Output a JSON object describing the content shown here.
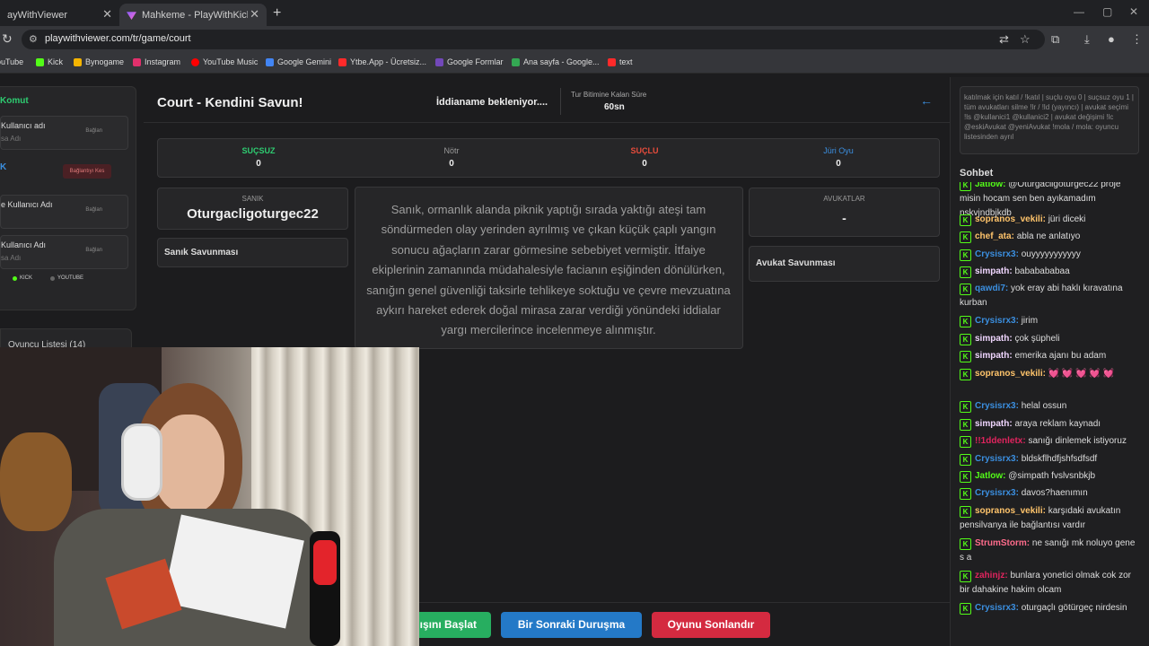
{
  "browser": {
    "tabs": [
      {
        "label": "ayWithViewer"
      },
      {
        "label": "Mahkeme - PlayWithKick | Play"
      }
    ],
    "url": "playwithviewer.com/tr/game/court",
    "bookmarks": [
      {
        "label": "ouTube",
        "color": "#ff0000"
      },
      {
        "label": "Kick",
        "color": "#53fc18"
      },
      {
        "label": "Bynogame",
        "color": "#f5b400"
      },
      {
        "label": "Instagram",
        "color": "#e1306c"
      },
      {
        "label": "YouTube Music",
        "color": "#ff0000"
      },
      {
        "label": "Google Gemini",
        "color": "#4285f4"
      },
      {
        "label": "Ytbe.App - Ücretsiz...",
        "color": "#ff2a2a"
      },
      {
        "label": "Google Formlar",
        "color": "#7248b9"
      },
      {
        "label": "Ana sayfa - Google...",
        "color": "#34a853"
      },
      {
        "label": "text",
        "color": "#ff2a2a"
      }
    ]
  },
  "left": {
    "komut": "Komut",
    "boxes": [
      {
        "title": "Kullanıcı adı",
        "sub": "sa Adı",
        "btn": "Bağlan"
      },
      {
        "title": "e Kullanıcı Adı",
        "sub": "",
        "btn": "Bağlan"
      },
      {
        "title": "Kullanıcı Adı",
        "sub": "sa Adı",
        "btn": "Bağlan"
      }
    ],
    "k_label": "K",
    "disconnect": "Bağlantıyı Kes",
    "platforms": [
      "KICK",
      "YOUTUBE"
    ],
    "player_list": "Oyuncu Listesi (14)"
  },
  "header": {
    "title": "Court - Kendini Savun!",
    "status": "İddianame bekleniyor....",
    "timer_label": "Tur Bitimine Kalan Süre",
    "timer_value": "60sn"
  },
  "votes": [
    {
      "label": "SUÇSUZ",
      "value": "0",
      "color": "#2ecc71"
    },
    {
      "label": "Nötr",
      "value": "0",
      "color": "#9a9a9a"
    },
    {
      "label": "SUÇLU",
      "value": "0",
      "color": "#e74c3c"
    },
    {
      "label": "Jüri Oyu",
      "value": "0",
      "color": "#3b8fe0"
    }
  ],
  "defendant": {
    "label": "SANIK",
    "name": "Oturgacligoturgec22",
    "defense_title": "Sanık Savunması"
  },
  "indictment": "Sanık, ormanlık alanda piknik yaptığı sırada yaktığı ateşi tam söndürmeden olay yerinden ayrılmış ve çıkan küçük çaplı yangın sonucu ağaçların zarar görmesine sebebiyet vermiştir. İtfaiye ekiplerinin zamanında müdahalesiyle facianın eşiğinden dönülürken, sanığın genel güvenliği taksirle tehlikeye soktuğu ve çevre mevzuatına aykırı hareket ederek doğal mirasa zarar verdiği yönündeki iddialar yargı mercilerince incelenmeye alınmıştır.",
  "lawyers": {
    "label": "AVUKATLAR",
    "value": "-",
    "defense_title": "Avukat Savunması"
  },
  "buttons": {
    "start": "ışını Başlat",
    "next": "Bir Sonraki Duruşma",
    "end": "Oyunu Sonlandır"
  },
  "commands_text": "katılmak için katıl / !katıl | suçlu oyu 0 | suçsuz oyu 1 | tüm avukatları silme !lr / !ld (yayıncı) | avukat seçimi !ls @kullanici1 @kullanici2 | avukat değişimi !lc @eskiAvukat @yeniAvukat !mola / mola: oyuncu listesinden ayrıl",
  "chat_title": "Sohbet",
  "chat": [
    {
      "user": "Jatlow:",
      "color": "#53fc18",
      "text": "@Oturgacligoturgec22 proje misin hocam sen ben ayıkamadım nskvjndbjkdb"
    },
    {
      "user": "sopranos_vekili:",
      "color": "#ffc46b",
      "text": "jüri diceki"
    },
    {
      "user": "chef_ata:",
      "color": "#ffc46b",
      "text": "abla ne anlatıyo"
    },
    {
      "user": "Crysisrx3:",
      "color": "#3b8fe0",
      "text": "ouyyyyyyyyyyy"
    },
    {
      "user": "simpath:",
      "color": "#f0d6ff",
      "text": "bababababaa"
    },
    {
      "user": "qawdi7:",
      "color": "#3b8fe0",
      "text": "yok eray abi haklı kıravatına kurban"
    },
    {
      "user": "Crysisrx3:",
      "color": "#3b8fe0",
      "text": "jirim"
    },
    {
      "user": "simpath:",
      "color": "#f0d6ff",
      "text": "çok şüpheli"
    },
    {
      "user": "simpath:",
      "color": "#f0d6ff",
      "text": "emerika ajanı bu adam"
    },
    {
      "user": "sopranos_vekili:",
      "color": "#ffc46b",
      "text": "💓 💓 💓 💓 💓"
    },
    {
      "user": "Crysisrx3:",
      "color": "#3b8fe0",
      "text": "helal ossun"
    },
    {
      "user": "simpath:",
      "color": "#f0d6ff",
      "text": "araya reklam kaynadı"
    },
    {
      "user": "!!1ddenletx:",
      "color": "#e0245e",
      "text": "sanığı dinlemek istiyoruz"
    },
    {
      "user": "Crysisrx3:",
      "color": "#3b8fe0",
      "text": "bldskflhdfjshfsdfsdf"
    },
    {
      "user": "Jatlow:",
      "color": "#53fc18",
      "text": "@simpath fvslvsnbkjb"
    },
    {
      "user": "Crysisrx3:",
      "color": "#3b8fe0",
      "text": "davos?haenımın"
    },
    {
      "user": "sopranos_vekili:",
      "color": "#ffc46b",
      "text": "karşıdaki avukatın pensilvanya ile bağlantısı vardır"
    },
    {
      "user": "StrumStorm:",
      "color": "#ff6b8b",
      "text": "ne sanığı mk noluyo gene s a"
    },
    {
      "user": "zahinjz:",
      "color": "#e0245e",
      "text": "bunlara yonetici olmak cok zor bir dahakine hakim olcam"
    },
    {
      "user": "Crysisrx3:",
      "color": "#3b8fe0",
      "text": "oturgaçlı götürgeç nirdesin"
    }
  ]
}
